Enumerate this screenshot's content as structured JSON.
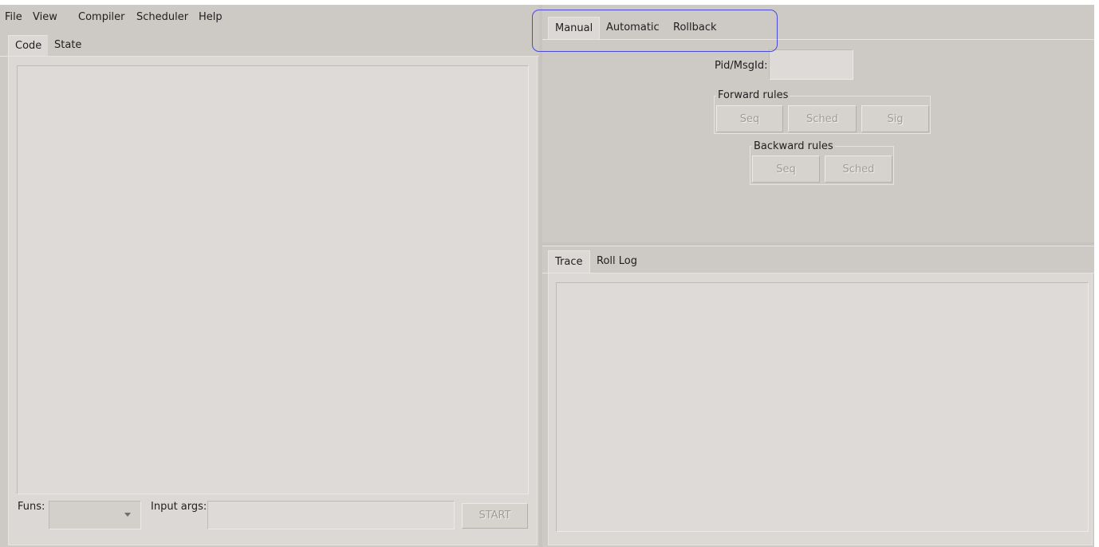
{
  "menubar": {
    "items": [
      "File",
      "View",
      "Compiler",
      "Scheduler",
      "Help"
    ]
  },
  "left_tabs": [
    "Code",
    "State"
  ],
  "bottom_bar": {
    "funs_label": "Funs:",
    "funs_value": "",
    "input_args_label": "Input args:",
    "input_args_value": "",
    "start_button": "START"
  },
  "mode_tabs": [
    "Manual",
    "Automatic",
    "Rollback"
  ],
  "manual": {
    "pid_label": "Pid/MsgId:",
    "pid_value": "",
    "forward": {
      "title": "Forward rules",
      "buttons": [
        "Seq",
        "Sched",
        "Sig"
      ]
    },
    "backward": {
      "title": "Backward rules",
      "buttons": [
        "Seq",
        "Sched"
      ]
    }
  },
  "log_tabs": [
    "Trace",
    "Roll Log"
  ],
  "colors": {
    "window_bg": "#cdc9c5",
    "panel_bg": "#dcd8d5",
    "highlight": "#4a4ad8"
  }
}
